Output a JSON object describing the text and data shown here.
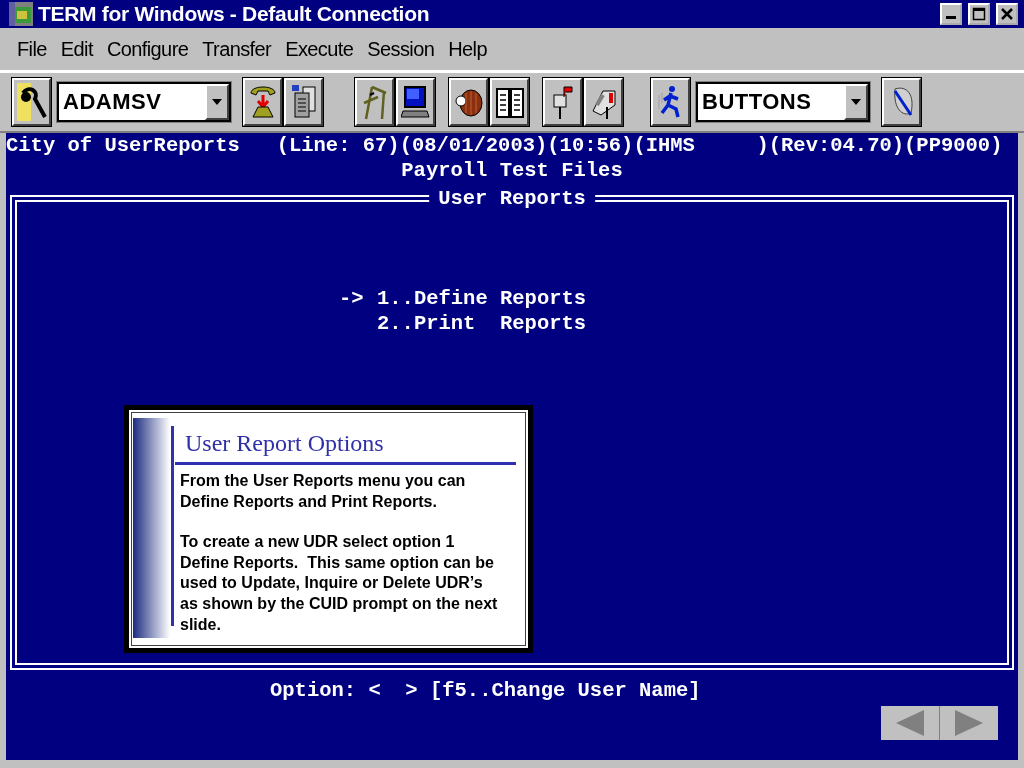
{
  "window": {
    "title": "TERM for Windows - Default Connection"
  },
  "menu": [
    "File",
    "Edit",
    "Configure",
    "Transfer",
    "Execute",
    "Session",
    "Help"
  ],
  "toolbar": {
    "session_combo": {
      "value": "ADAMSV"
    },
    "button_set_combo": {
      "value": "BUTTONS"
    }
  },
  "terminal": {
    "status_line": "City of UserReports   (Line: 67)(08/01/2003)(10:56)(IHMS     )(Rev:04.70)(PP9000)",
    "subtitle": "Payroll Test Files",
    "frame_title": "User Reports",
    "cursor": "->",
    "options": [
      {
        "label": "1..Define Reports",
        "selected": true
      },
      {
        "label": "2..Print  Reports",
        "selected": false
      }
    ],
    "prompt": "Option: <  > [f5..Change User Name]"
  },
  "callout": {
    "title": "User Report Options",
    "paragraphs": [
      "From the User Reports menu you can Define Reports and Print Reports.",
      "To create a new UDR select option 1 Define Reports.  This same option can be used to Update, Inquire or Delete UDR’s as shown by the CUID prompt on the next slide."
    ]
  }
}
